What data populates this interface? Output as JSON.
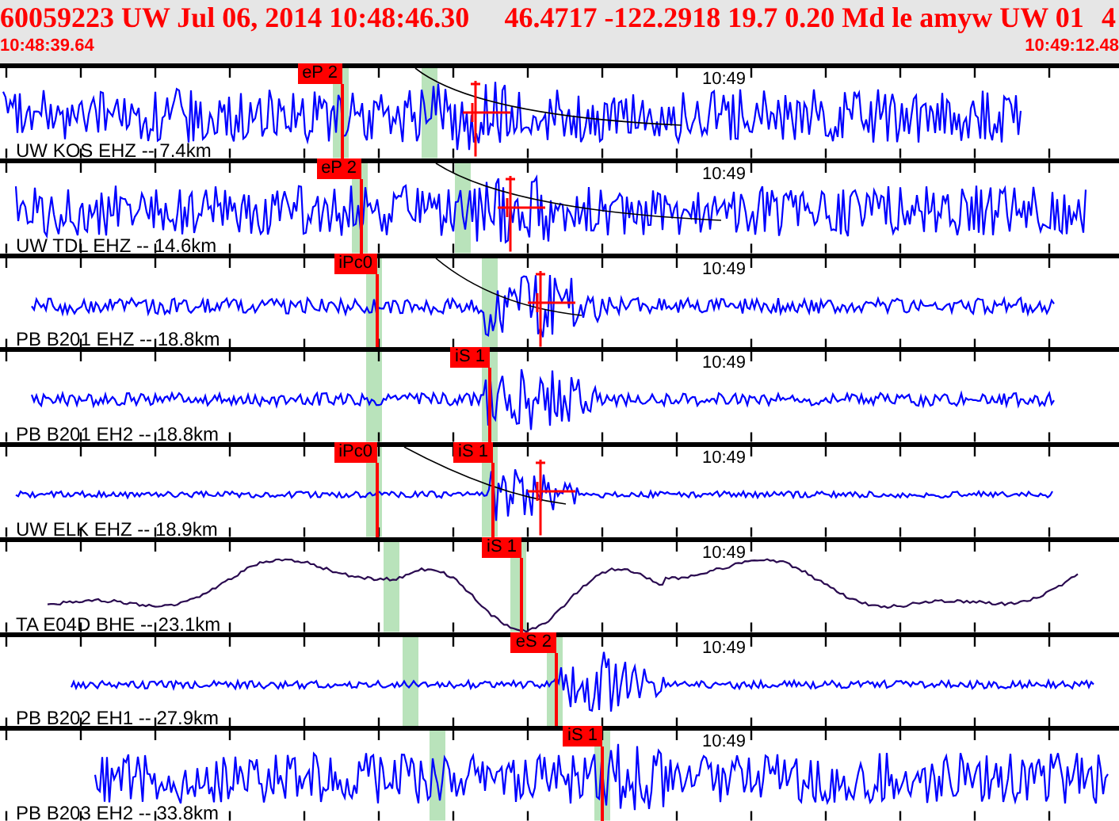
{
  "header": {
    "event": "60059223 UW Jul 06, 2014 10:48:46.30",
    "location": "46.4717 -122.2918 19.7 0.20 Md le amyw UW 01",
    "trailing": "4",
    "start_time": "10:48:39.64",
    "end_time": "10:49:12.48"
  },
  "traces": [
    {
      "label": "UW KOS EHZ -- 7.4km",
      "time_mark": "10:49",
      "kind": "short-period",
      "color": "#0000ff",
      "picks": [
        {
          "label": "eP 2"
        }
      ]
    },
    {
      "label": "UW TDL EHZ -- 14.6km",
      "time_mark": "10:49",
      "kind": "short-period",
      "color": "#0000ff",
      "picks": [
        {
          "label": "eP 2"
        }
      ]
    },
    {
      "label": "PB B201 EHZ -- 18.8km",
      "time_mark": "10:49",
      "kind": "short-period",
      "color": "#0000ff",
      "picks": [
        {
          "label": "iPc0"
        }
      ]
    },
    {
      "label": "PB B201 EH2 -- 18.8km",
      "time_mark": "10:49",
      "kind": "short-period",
      "color": "#0000ff",
      "picks": [
        {
          "label": "iS 1"
        }
      ]
    },
    {
      "label": "UW ELK EHZ -- 18.9km",
      "time_mark": "10:49",
      "kind": "short-period",
      "color": "#0000ff",
      "picks": [
        {
          "label": "iPc0"
        },
        {
          "label": "iS 1"
        }
      ]
    },
    {
      "label": "TA E04D BHE -- 23.1km",
      "time_mark": "10:49",
      "kind": "long-period",
      "color": "#2a0a50",
      "picks": [
        {
          "label": "iS 1"
        }
      ]
    },
    {
      "label": "PB B202 EH1 -- 27.9km",
      "time_mark": "10:49",
      "kind": "short-period",
      "color": "#0000ff",
      "picks": [
        {
          "label": "eS 2"
        }
      ]
    },
    {
      "label": "PB B203 EH2 -- 33.8km",
      "time_mark": "10:49",
      "kind": "short-period",
      "color": "#0000ff",
      "picks": [
        {
          "label": "iS 1"
        }
      ]
    }
  ]
}
